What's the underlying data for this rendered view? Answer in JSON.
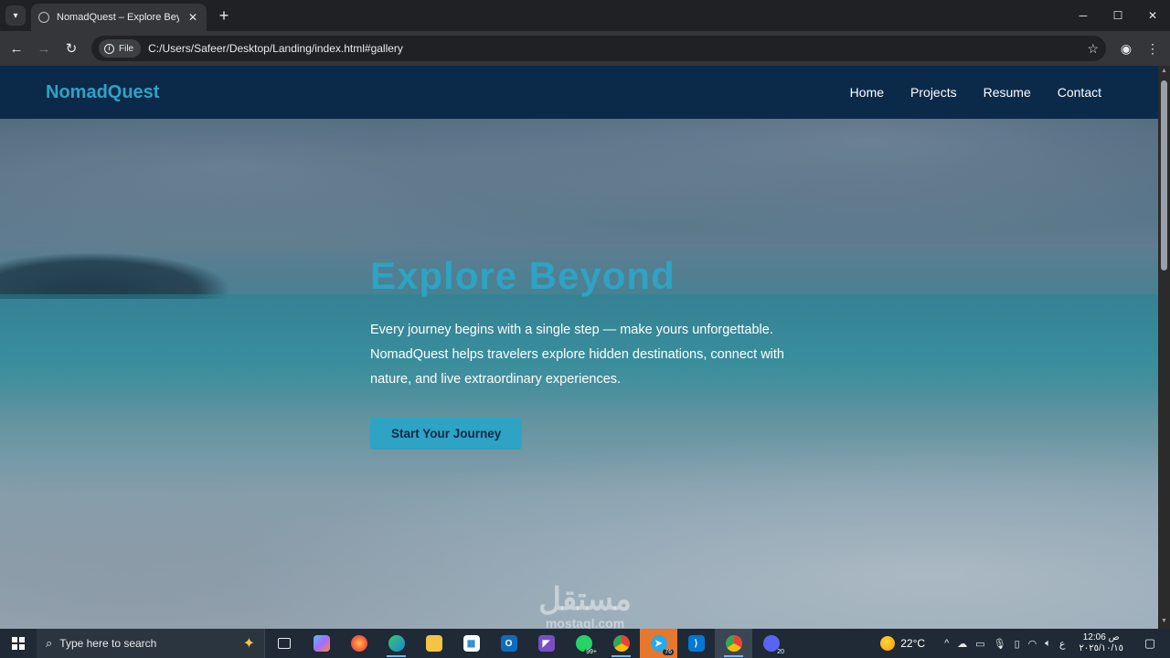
{
  "browser": {
    "tab_title": "NomadQuest – Explore Beyond",
    "tab_close": "✕",
    "new_tab": "+",
    "chip_label": "File",
    "url": "C:/Users/Safeer/Desktop/Landing/index.html#gallery"
  },
  "site": {
    "brand": "NomadQuest",
    "nav": [
      "Home",
      "Projects",
      "Resume",
      "Contact"
    ],
    "hero_title": "Explore Beyond",
    "hero_text": "Every journey begins with a single step — make yours unforgettable. NomadQuest helps travelers explore hidden destinations, connect with nature, and live extraordinary experiences.",
    "cta": "Start Your Journey"
  },
  "watermark": {
    "arabic": "مستقل",
    "latin": "mostaql.com"
  },
  "taskbar": {
    "search_placeholder": "Type here to search",
    "badges": {
      "whatsapp": "99+",
      "telegram": "76",
      "discord": "20"
    },
    "weather": "22°C",
    "lang": "ع",
    "time": "12:06 ص",
    "date": "٢٠٢٥/١٠/١٥"
  },
  "colors": {
    "accent": "#2ea3c4",
    "nav_bg": "#0b2a4a",
    "browser_bg": "#202124",
    "taskbar_bg": "#1f2a36"
  }
}
